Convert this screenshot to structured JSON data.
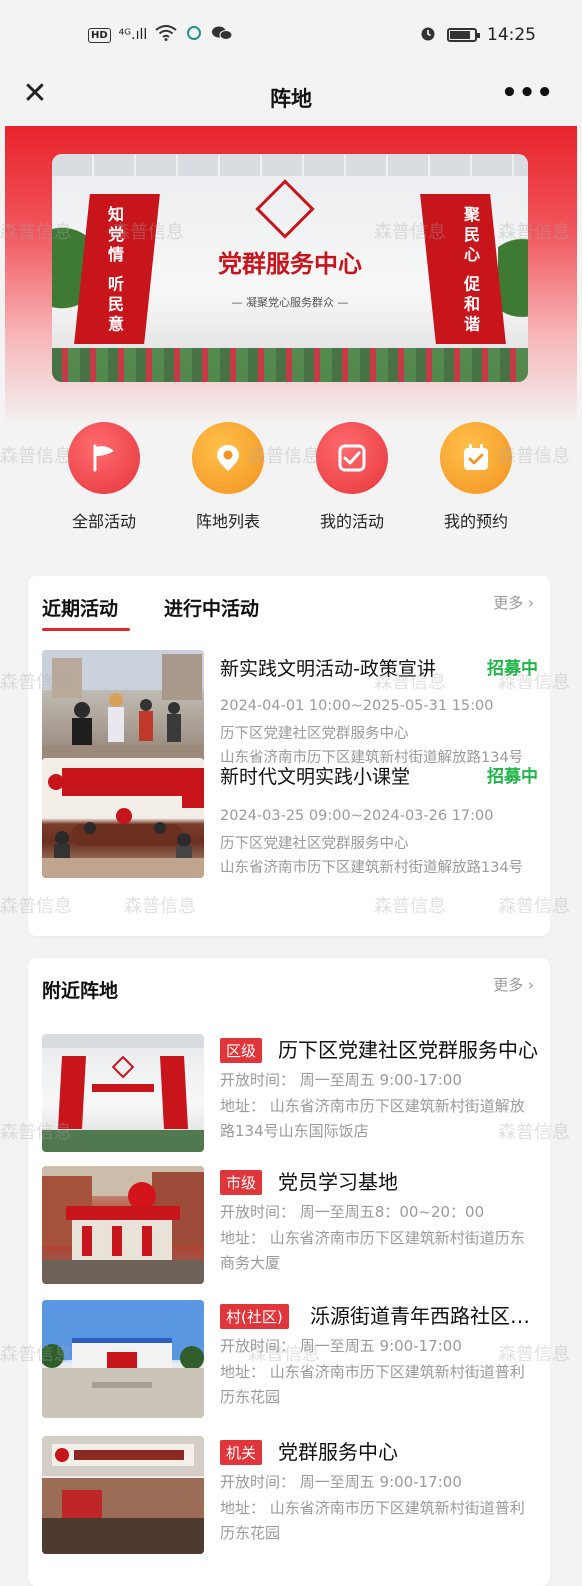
{
  "status_bar": {
    "badge": "HD",
    "signal": "⁴ᴳ.ıll",
    "time": "14:25"
  },
  "nav": {
    "title": "阵地",
    "close_icon": "close-icon",
    "more_icon": "more-dots-icon"
  },
  "watermark": "森普信息",
  "banner": {
    "center_title": "党群服务中心",
    "subtitle": "— 凝聚党心服务群众 —",
    "left_text": "知党情 听民意",
    "right_text": "聚民心 促和谐"
  },
  "quick_entries": [
    {
      "label": "全部活动",
      "icon": "flag-icon",
      "color": "#e5363b"
    },
    {
      "label": "阵地列表",
      "icon": "map-pin-icon",
      "color": "#f39321"
    },
    {
      "label": "我的活动",
      "icon": "checkbox-icon",
      "color": "#e5363b"
    },
    {
      "label": "我的预约",
      "icon": "calendar-check-icon",
      "color": "#f39321"
    }
  ],
  "activities": {
    "tabs": [
      "近期活动",
      "进行中活动"
    ],
    "more": "更多",
    "items": [
      {
        "title": "新实践文明活动-政策宣讲",
        "status": "招募中",
        "time": "2024-04-01 10:00~2025-05-31 15:00",
        "org": "历下区党建社区党群服务中心",
        "address": "山东省济南市历下区建筑新村街道解放路134号"
      },
      {
        "title": "新时代文明实践小课堂",
        "status": "招募中",
        "time": "2024-03-25 09:00~2024-03-26 17:00",
        "org": "历下区党建社区党群服务中心",
        "address": "山东省济南市历下区建筑新村街道解放路134号"
      }
    ]
  },
  "nearby": {
    "title": "附近阵地",
    "more": "更多",
    "items": [
      {
        "badge": "区级",
        "title": "历下区党建社区党群服务中心",
        "hours": "开放时间：  周一至周五 9:00-17:00",
        "address": "地址：  山东省济南市历下区建筑新村街道解放路134号山东国际饭店"
      },
      {
        "badge": "市级",
        "title": "党员学习基地",
        "hours": "开放时间：  周一至周五8：00~20：00",
        "address": "地址：  山东省济南市历下区建筑新村街道历东商务大厦"
      },
      {
        "badge": "村(社区)",
        "title": "泺源街道青年西路社区党群服务中心",
        "hours": "开放时间：  周一至周五 9:00-17:00",
        "address": "地址：  山东省济南市历下区建筑新村街道普利历东花园"
      },
      {
        "badge": "机关",
        "title": "党群服务中心",
        "hours": "开放时间：  周一至周五 9:00-17:00",
        "address": "地址：  山东省济南市历下区建筑新村街道普利历东花园"
      }
    ]
  }
}
